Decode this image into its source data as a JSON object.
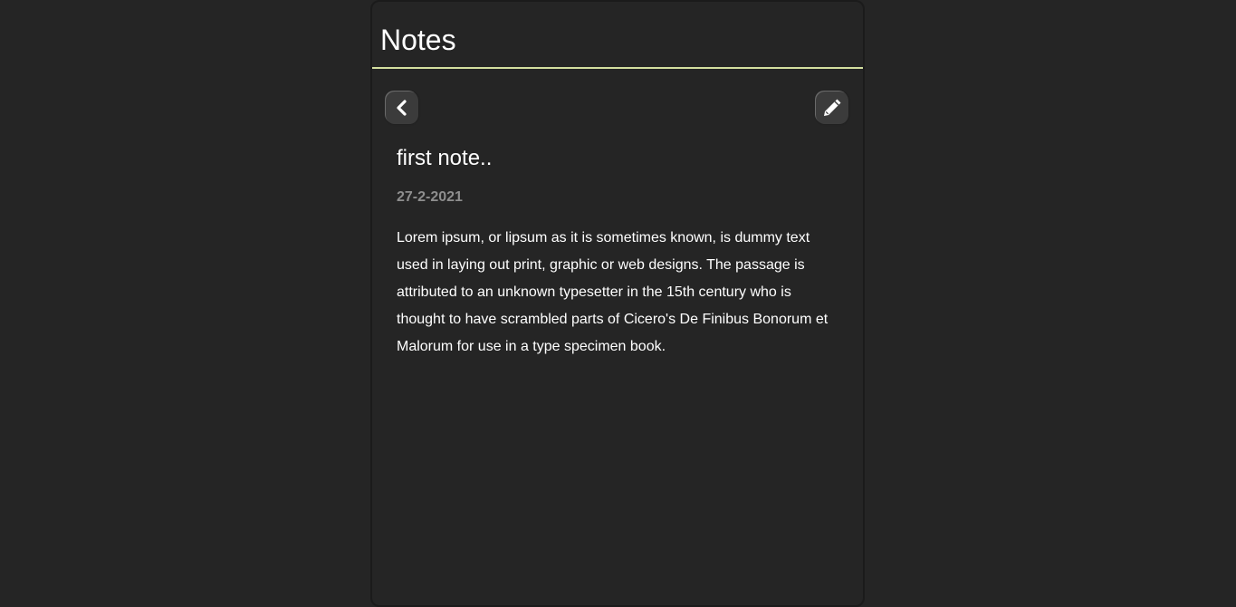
{
  "header": {
    "title": "Notes"
  },
  "toolbar": {
    "back_icon": "chevron-left-icon",
    "edit_icon": "pencil-icon"
  },
  "note": {
    "title": "first note..",
    "date": "27-2-2021",
    "body": "Lorem ipsum, or lipsum as it is sometimes known, is dummy text used in laying out print, graphic or web designs. The passage is attributed to an unknown typesetter in the 15th century who is thought to have scrambled parts of Cicero's De Finibus Bonorum et Malorum for use in a type specimen book."
  },
  "colors": {
    "background": "#252525",
    "accent_line": "#d4dfa0",
    "text": "#ffffff",
    "date_text": "#8e8e8e",
    "button_bg": "#3b3b3b"
  }
}
